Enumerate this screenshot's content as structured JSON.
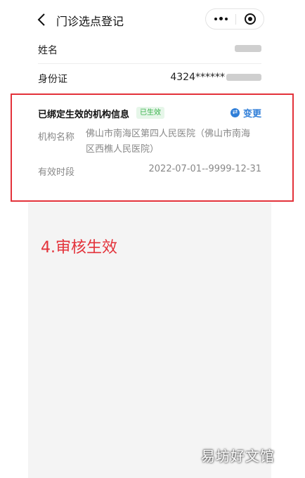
{
  "header": {
    "title": "门诊选点登记"
  },
  "profile": {
    "name_label": "姓名",
    "id_label": "身份证",
    "id_value_prefix": "4324******"
  },
  "binding_card": {
    "title": "已绑定生效的机构信息",
    "status_badge": "已生效",
    "change_label": "变更",
    "org_label": "机构名称",
    "org_value_line1": "佛山市南海区第四人民医院（佛山市南海",
    "org_value_line2": "区西樵人民医院）",
    "period_label": "有效时段",
    "period_value": "2022-07-01--9999-12-31"
  },
  "annotation": {
    "step_text": "4.审核生效",
    "color": "#e3323a"
  },
  "watermark": {
    "text": "易坊好文馆"
  },
  "colors": {
    "accent_blue": "#2f7ed8",
    "badge_green": "#38b24a",
    "badge_bg": "#e6f6e9",
    "panel_grey": "#f4f4f4"
  }
}
